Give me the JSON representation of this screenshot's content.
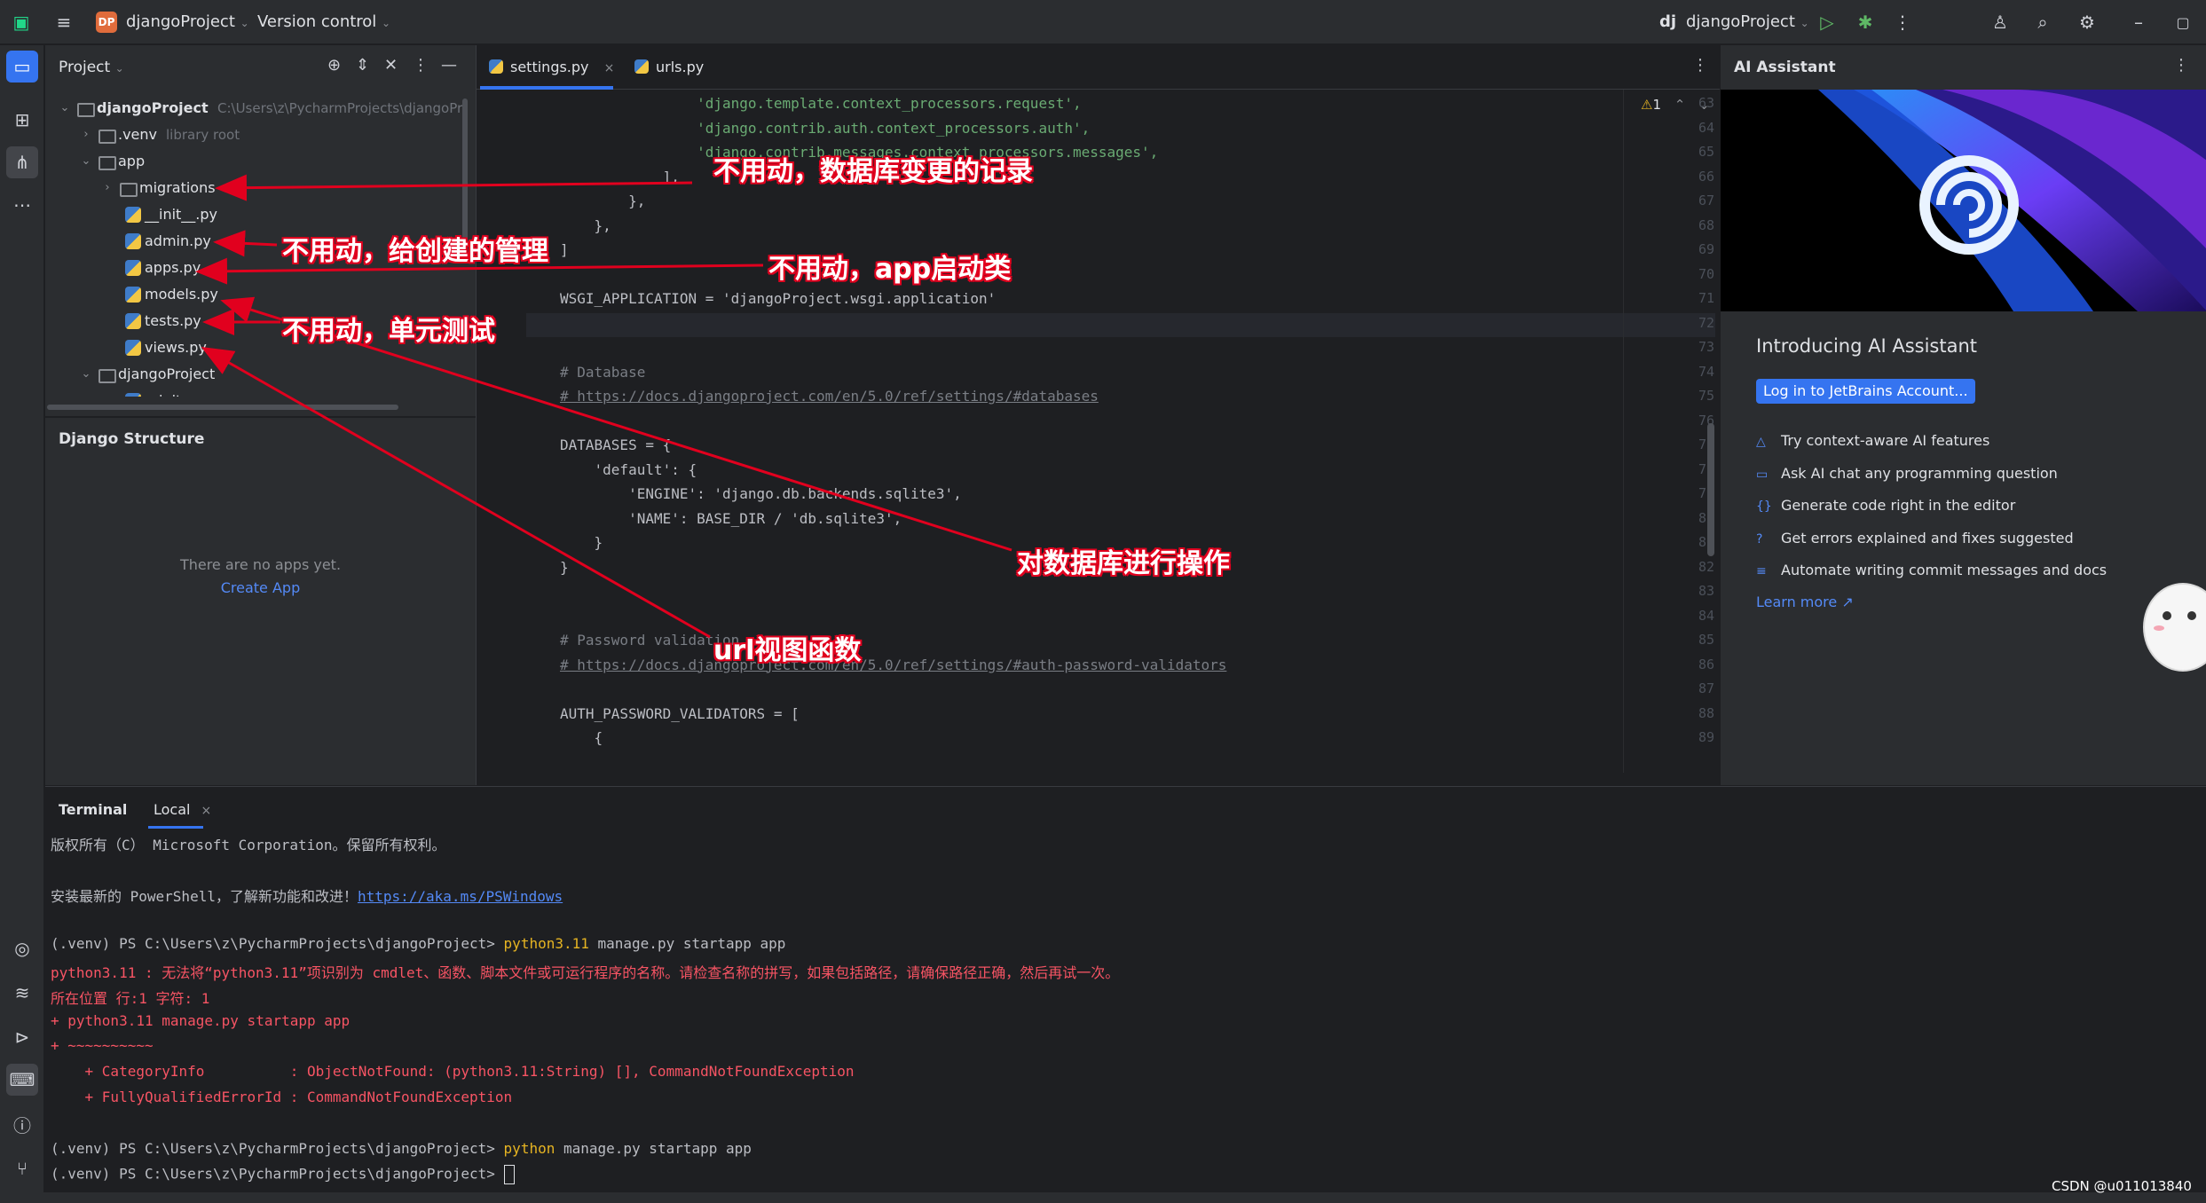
{
  "titlebar": {
    "project_badge": "DP",
    "project_name": "djangoProject",
    "vcs": "Version control",
    "run_config_badge": "dj",
    "run_config": "djangoProject"
  },
  "project_panel": {
    "title": "Project",
    "tree": [
      {
        "label": "djangoProject",
        "hint": "C:\\Users\\z\\PycharmProjects\\djangoPr",
        "type": "folder",
        "expanded": true
      },
      {
        "label": ".venv",
        "hint": "library root",
        "type": "folder",
        "expanded": false
      },
      {
        "label": "app",
        "hint": "",
        "type": "folder",
        "expanded": true
      },
      {
        "label": "migrations",
        "hint": "",
        "type": "folder",
        "expanded": false
      },
      {
        "label": "__init__.py",
        "hint": "",
        "type": "py"
      },
      {
        "label": "admin.py",
        "hint": "",
        "type": "py"
      },
      {
        "label": "apps.py",
        "hint": "",
        "type": "py"
      },
      {
        "label": "models.py",
        "hint": "",
        "type": "py"
      },
      {
        "label": "tests.py",
        "hint": "",
        "type": "py"
      },
      {
        "label": "views.py",
        "hint": "",
        "type": "py"
      },
      {
        "label": "djangoProject",
        "hint": "",
        "type": "folder",
        "expanded": true
      },
      {
        "label": "__init__.py",
        "hint": "",
        "type": "py"
      }
    ]
  },
  "structure_panel": {
    "title": "Django Structure",
    "empty_text": "There are no apps yet.",
    "create_link": "Create App"
  },
  "editor": {
    "tabs": [
      {
        "label": "settings.py",
        "active": true
      },
      {
        "label": "urls.py",
        "active": false
      }
    ],
    "warning_count": "1",
    "lines": [
      {
        "n": "63",
        "text": "                'django.template.context_processors.request',",
        "kind": "str"
      },
      {
        "n": "64",
        "text": "                'django.contrib.auth.context_processors.auth',",
        "kind": "str"
      },
      {
        "n": "65",
        "text": "                'django.contrib.messages.context_processors.messages',",
        "kind": "str"
      },
      {
        "n": "66",
        "text": "            ],",
        "kind": "plain"
      },
      {
        "n": "67",
        "text": "        },",
        "kind": "plain"
      },
      {
        "n": "68",
        "text": "    },",
        "kind": "plain"
      },
      {
        "n": "69",
        "text": "]",
        "kind": "plain"
      },
      {
        "n": "70",
        "text": "",
        "kind": "plain"
      },
      {
        "n": "71",
        "text": "WSGI_APPLICATION = 'djangoProject.wsgi.application'",
        "kind": "mixed"
      },
      {
        "n": "72",
        "text": "",
        "kind": "plain"
      },
      {
        "n": "73",
        "text": "",
        "kind": "plain"
      },
      {
        "n": "74",
        "text": "# Database",
        "kind": "cmt"
      },
      {
        "n": "75",
        "text": "# https://docs.djangoproject.com/en/5.0/ref/settings/#databases",
        "kind": "link"
      },
      {
        "n": "76",
        "text": "",
        "kind": "plain"
      },
      {
        "n": "77",
        "text": "DATABASES = {",
        "kind": "plain"
      },
      {
        "n": "78",
        "text": "    'default': {",
        "kind": "str"
      },
      {
        "n": "79",
        "text": "        'ENGINE': 'django.db.backends.sqlite3',",
        "kind": "str"
      },
      {
        "n": "80",
        "text": "        'NAME': BASE_DIR / 'db.sqlite3',",
        "kind": "str"
      },
      {
        "n": "81",
        "text": "    }",
        "kind": "plain"
      },
      {
        "n": "82",
        "text": "}",
        "kind": "plain"
      },
      {
        "n": "83",
        "text": "",
        "kind": "plain"
      },
      {
        "n": "84",
        "text": "",
        "kind": "plain"
      },
      {
        "n": "85",
        "text": "# Password validation",
        "kind": "cmt"
      },
      {
        "n": "86",
        "text": "# https://docs.djangoproject.com/en/5.0/ref/settings/#auth-password-validators",
        "kind": "link"
      },
      {
        "n": "87",
        "text": "",
        "kind": "plain"
      },
      {
        "n": "88",
        "text": "AUTH_PASSWORD_VALIDATORS = [",
        "kind": "plain"
      },
      {
        "n": "89",
        "text": "    {",
        "kind": "plain"
      }
    ]
  },
  "ai_panel": {
    "title": "AI Assistant",
    "heading": "Introducing AI Assistant",
    "login_button": "Log in to JetBrains Account...",
    "features": [
      {
        "icon": "context-icon",
        "text": "Try context-aware AI features"
      },
      {
        "icon": "chat-icon",
        "text": "Ask AI chat any programming question"
      },
      {
        "icon": "braces-icon",
        "text": "Generate code right in the editor"
      },
      {
        "icon": "question-icon",
        "text": "Get errors explained and fixes suggested"
      },
      {
        "icon": "lines-icon",
        "text": "Automate writing commit messages and docs"
      }
    ],
    "learn_more": "Learn more ↗"
  },
  "terminal": {
    "title": "Terminal",
    "tab": "Local",
    "lines": [
      {
        "text": "版权所有（C） Microsoft Corporation。保留所有权利。",
        "kind": "plain"
      },
      {
        "text": "",
        "kind": "plain"
      },
      {
        "text": "安装最新的 PowerShell，了解新功能和改进！",
        "link": "https://aka.ms/PSWindows",
        "kind": "link"
      },
      {
        "text": "",
        "kind": "plain"
      },
      {
        "text": "(.venv) PS C:\\Users\\z\\PycharmProjects\\djangoProject> ",
        "cmd": "python3.11",
        "rest": " manage.py startapp app",
        "kind": "prompt"
      },
      {
        "text": "python3.11 : 无法将“python3.11”项识别为 cmdlet、函数、脚本文件或可运行程序的名称。请检查名称的拼写，如果包括路径，请确保路径正确，然后再试一次。",
        "kind": "red"
      },
      {
        "text": "所在位置 行:1 字符: 1",
        "kind": "red"
      },
      {
        "text": "+ python3.11 manage.py startapp app",
        "kind": "red"
      },
      {
        "text": "+ ~~~~~~~~~~",
        "kind": "red"
      },
      {
        "text": "    + CategoryInfo          : ObjectNotFound: (python3.11:String) [], CommandNotFoundException",
        "kind": "red"
      },
      {
        "text": "    + FullyQualifiedErrorId : CommandNotFoundException",
        "kind": "red"
      },
      {
        "text": "",
        "kind": "plain"
      },
      {
        "text": "(.venv) PS C:\\Users\\z\\PycharmProjects\\djangoProject> ",
        "cmd": "python",
        "rest": " manage.py startapp app",
        "kind": "prompt"
      },
      {
        "text": "(.venv) PS C:\\Users\\z\\PycharmProjects\\djangoProject> ",
        "cmd": "",
        "rest": "",
        "kind": "prompt-cursor"
      }
    ]
  },
  "annotations": {
    "migrations": "不用动，数据库变更的记录",
    "admin": "不用动，给创建的管理",
    "apps": "不用动，app启动类",
    "tests": "不用动，单元测试",
    "models": "对数据库进行操作",
    "views": "url视图函数",
    "arrow_color": "#e1001e"
  },
  "watermark": "CSDN @u011013840"
}
